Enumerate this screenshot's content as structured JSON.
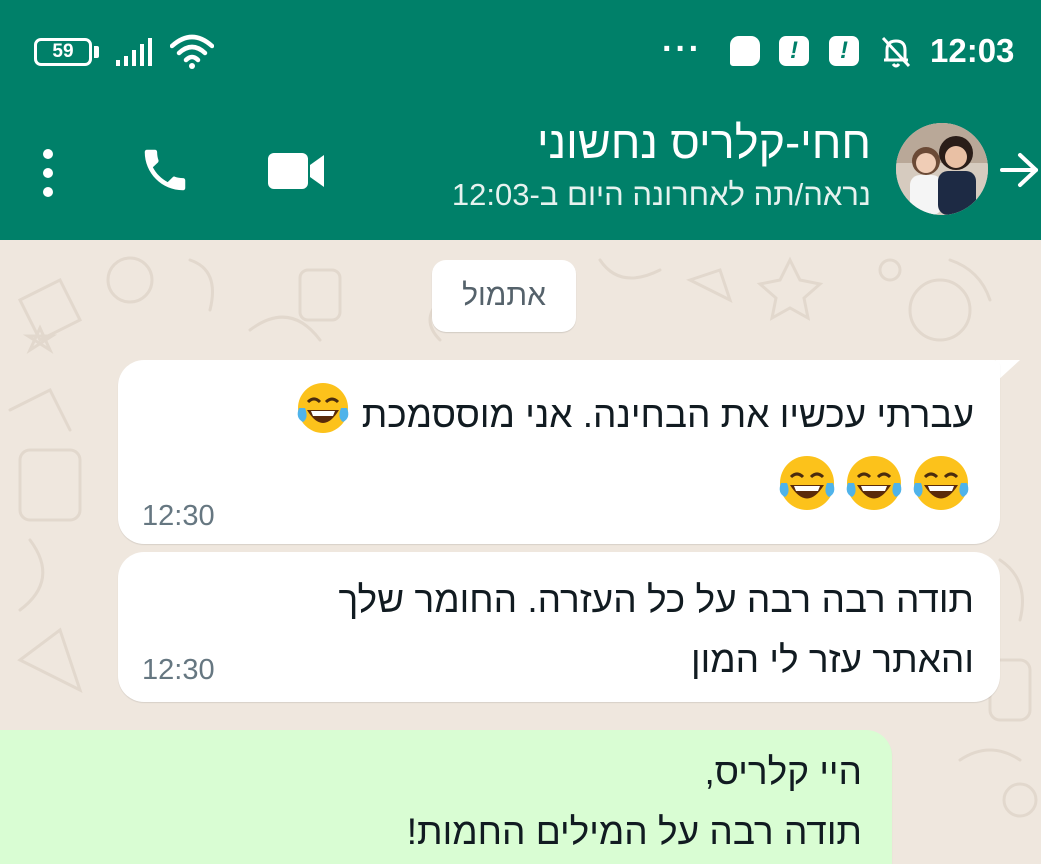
{
  "status_bar": {
    "battery": "59",
    "time": "12:03",
    "overflow": "···",
    "notif_mark": "!"
  },
  "header": {
    "contact_name": "חחי-קלריס נחשוני",
    "last_seen": "נראה/תה לאחרונה היום ב-12:03",
    "icons": [
      "back-arrow-icon",
      "video-call-icon",
      "voice-call-icon",
      "more-options-icon"
    ]
  },
  "chat": {
    "date_chip": "אתמול",
    "messages": [
      {
        "direction": "incoming",
        "line1": "עברתי עכשיו את הבחינה. אני מוססמכת",
        "line1_emoji": "😂",
        "line2_emoji": "😂😂😂",
        "time": "12:30"
      },
      {
        "direction": "incoming",
        "line1": "תודה רבה רבה על כל העזרה. החומר שלך",
        "line2": "והאתר עזר לי המון",
        "time": "12:30"
      },
      {
        "direction": "outgoing",
        "line1": "היי קלריס,",
        "line2": "תודה רבה על המילים החמות!"
      }
    ]
  },
  "colors": {
    "header_green": "#008069",
    "chat_bg": "#efe7de",
    "outgoing_bubble": "#d9fdd3",
    "incoming_bubble": "#ffffff"
  }
}
